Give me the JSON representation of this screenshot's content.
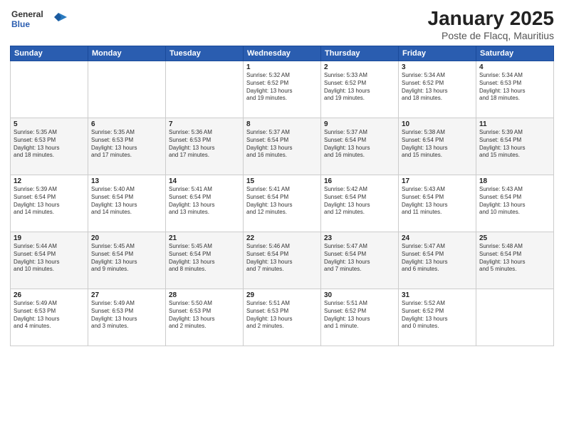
{
  "logo": {
    "general": "General",
    "blue": "Blue"
  },
  "header": {
    "title": "January 2025",
    "subtitle": "Poste de Flacq, Mauritius"
  },
  "days_of_week": [
    "Sunday",
    "Monday",
    "Tuesday",
    "Wednesday",
    "Thursday",
    "Friday",
    "Saturday"
  ],
  "weeks": [
    [
      {
        "day": "",
        "info": ""
      },
      {
        "day": "",
        "info": ""
      },
      {
        "day": "",
        "info": ""
      },
      {
        "day": "1",
        "info": "Sunrise: 5:32 AM\nSunset: 6:52 PM\nDaylight: 13 hours\nand 19 minutes."
      },
      {
        "day": "2",
        "info": "Sunrise: 5:33 AM\nSunset: 6:52 PM\nDaylight: 13 hours\nand 19 minutes."
      },
      {
        "day": "3",
        "info": "Sunrise: 5:34 AM\nSunset: 6:52 PM\nDaylight: 13 hours\nand 18 minutes."
      },
      {
        "day": "4",
        "info": "Sunrise: 5:34 AM\nSunset: 6:53 PM\nDaylight: 13 hours\nand 18 minutes."
      }
    ],
    [
      {
        "day": "5",
        "info": "Sunrise: 5:35 AM\nSunset: 6:53 PM\nDaylight: 13 hours\nand 18 minutes."
      },
      {
        "day": "6",
        "info": "Sunrise: 5:35 AM\nSunset: 6:53 PM\nDaylight: 13 hours\nand 17 minutes."
      },
      {
        "day": "7",
        "info": "Sunrise: 5:36 AM\nSunset: 6:53 PM\nDaylight: 13 hours\nand 17 minutes."
      },
      {
        "day": "8",
        "info": "Sunrise: 5:37 AM\nSunset: 6:54 PM\nDaylight: 13 hours\nand 16 minutes."
      },
      {
        "day": "9",
        "info": "Sunrise: 5:37 AM\nSunset: 6:54 PM\nDaylight: 13 hours\nand 16 minutes."
      },
      {
        "day": "10",
        "info": "Sunrise: 5:38 AM\nSunset: 6:54 PM\nDaylight: 13 hours\nand 15 minutes."
      },
      {
        "day": "11",
        "info": "Sunrise: 5:39 AM\nSunset: 6:54 PM\nDaylight: 13 hours\nand 15 minutes."
      }
    ],
    [
      {
        "day": "12",
        "info": "Sunrise: 5:39 AM\nSunset: 6:54 PM\nDaylight: 13 hours\nand 14 minutes."
      },
      {
        "day": "13",
        "info": "Sunrise: 5:40 AM\nSunset: 6:54 PM\nDaylight: 13 hours\nand 14 minutes."
      },
      {
        "day": "14",
        "info": "Sunrise: 5:41 AM\nSunset: 6:54 PM\nDaylight: 13 hours\nand 13 minutes."
      },
      {
        "day": "15",
        "info": "Sunrise: 5:41 AM\nSunset: 6:54 PM\nDaylight: 13 hours\nand 12 minutes."
      },
      {
        "day": "16",
        "info": "Sunrise: 5:42 AM\nSunset: 6:54 PM\nDaylight: 13 hours\nand 12 minutes."
      },
      {
        "day": "17",
        "info": "Sunrise: 5:43 AM\nSunset: 6:54 PM\nDaylight: 13 hours\nand 11 minutes."
      },
      {
        "day": "18",
        "info": "Sunrise: 5:43 AM\nSunset: 6:54 PM\nDaylight: 13 hours\nand 10 minutes."
      }
    ],
    [
      {
        "day": "19",
        "info": "Sunrise: 5:44 AM\nSunset: 6:54 PM\nDaylight: 13 hours\nand 10 minutes."
      },
      {
        "day": "20",
        "info": "Sunrise: 5:45 AM\nSunset: 6:54 PM\nDaylight: 13 hours\nand 9 minutes."
      },
      {
        "day": "21",
        "info": "Sunrise: 5:45 AM\nSunset: 6:54 PM\nDaylight: 13 hours\nand 8 minutes."
      },
      {
        "day": "22",
        "info": "Sunrise: 5:46 AM\nSunset: 6:54 PM\nDaylight: 13 hours\nand 7 minutes."
      },
      {
        "day": "23",
        "info": "Sunrise: 5:47 AM\nSunset: 6:54 PM\nDaylight: 13 hours\nand 7 minutes."
      },
      {
        "day": "24",
        "info": "Sunrise: 5:47 AM\nSunset: 6:54 PM\nDaylight: 13 hours\nand 6 minutes."
      },
      {
        "day": "25",
        "info": "Sunrise: 5:48 AM\nSunset: 6:54 PM\nDaylight: 13 hours\nand 5 minutes."
      }
    ],
    [
      {
        "day": "26",
        "info": "Sunrise: 5:49 AM\nSunset: 6:53 PM\nDaylight: 13 hours\nand 4 minutes."
      },
      {
        "day": "27",
        "info": "Sunrise: 5:49 AM\nSunset: 6:53 PM\nDaylight: 13 hours\nand 3 minutes."
      },
      {
        "day": "28",
        "info": "Sunrise: 5:50 AM\nSunset: 6:53 PM\nDaylight: 13 hours\nand 2 minutes."
      },
      {
        "day": "29",
        "info": "Sunrise: 5:51 AM\nSunset: 6:53 PM\nDaylight: 13 hours\nand 2 minutes."
      },
      {
        "day": "30",
        "info": "Sunrise: 5:51 AM\nSunset: 6:52 PM\nDaylight: 13 hours\nand 1 minute."
      },
      {
        "day": "31",
        "info": "Sunrise: 5:52 AM\nSunset: 6:52 PM\nDaylight: 13 hours\nand 0 minutes."
      },
      {
        "day": "",
        "info": ""
      }
    ]
  ]
}
